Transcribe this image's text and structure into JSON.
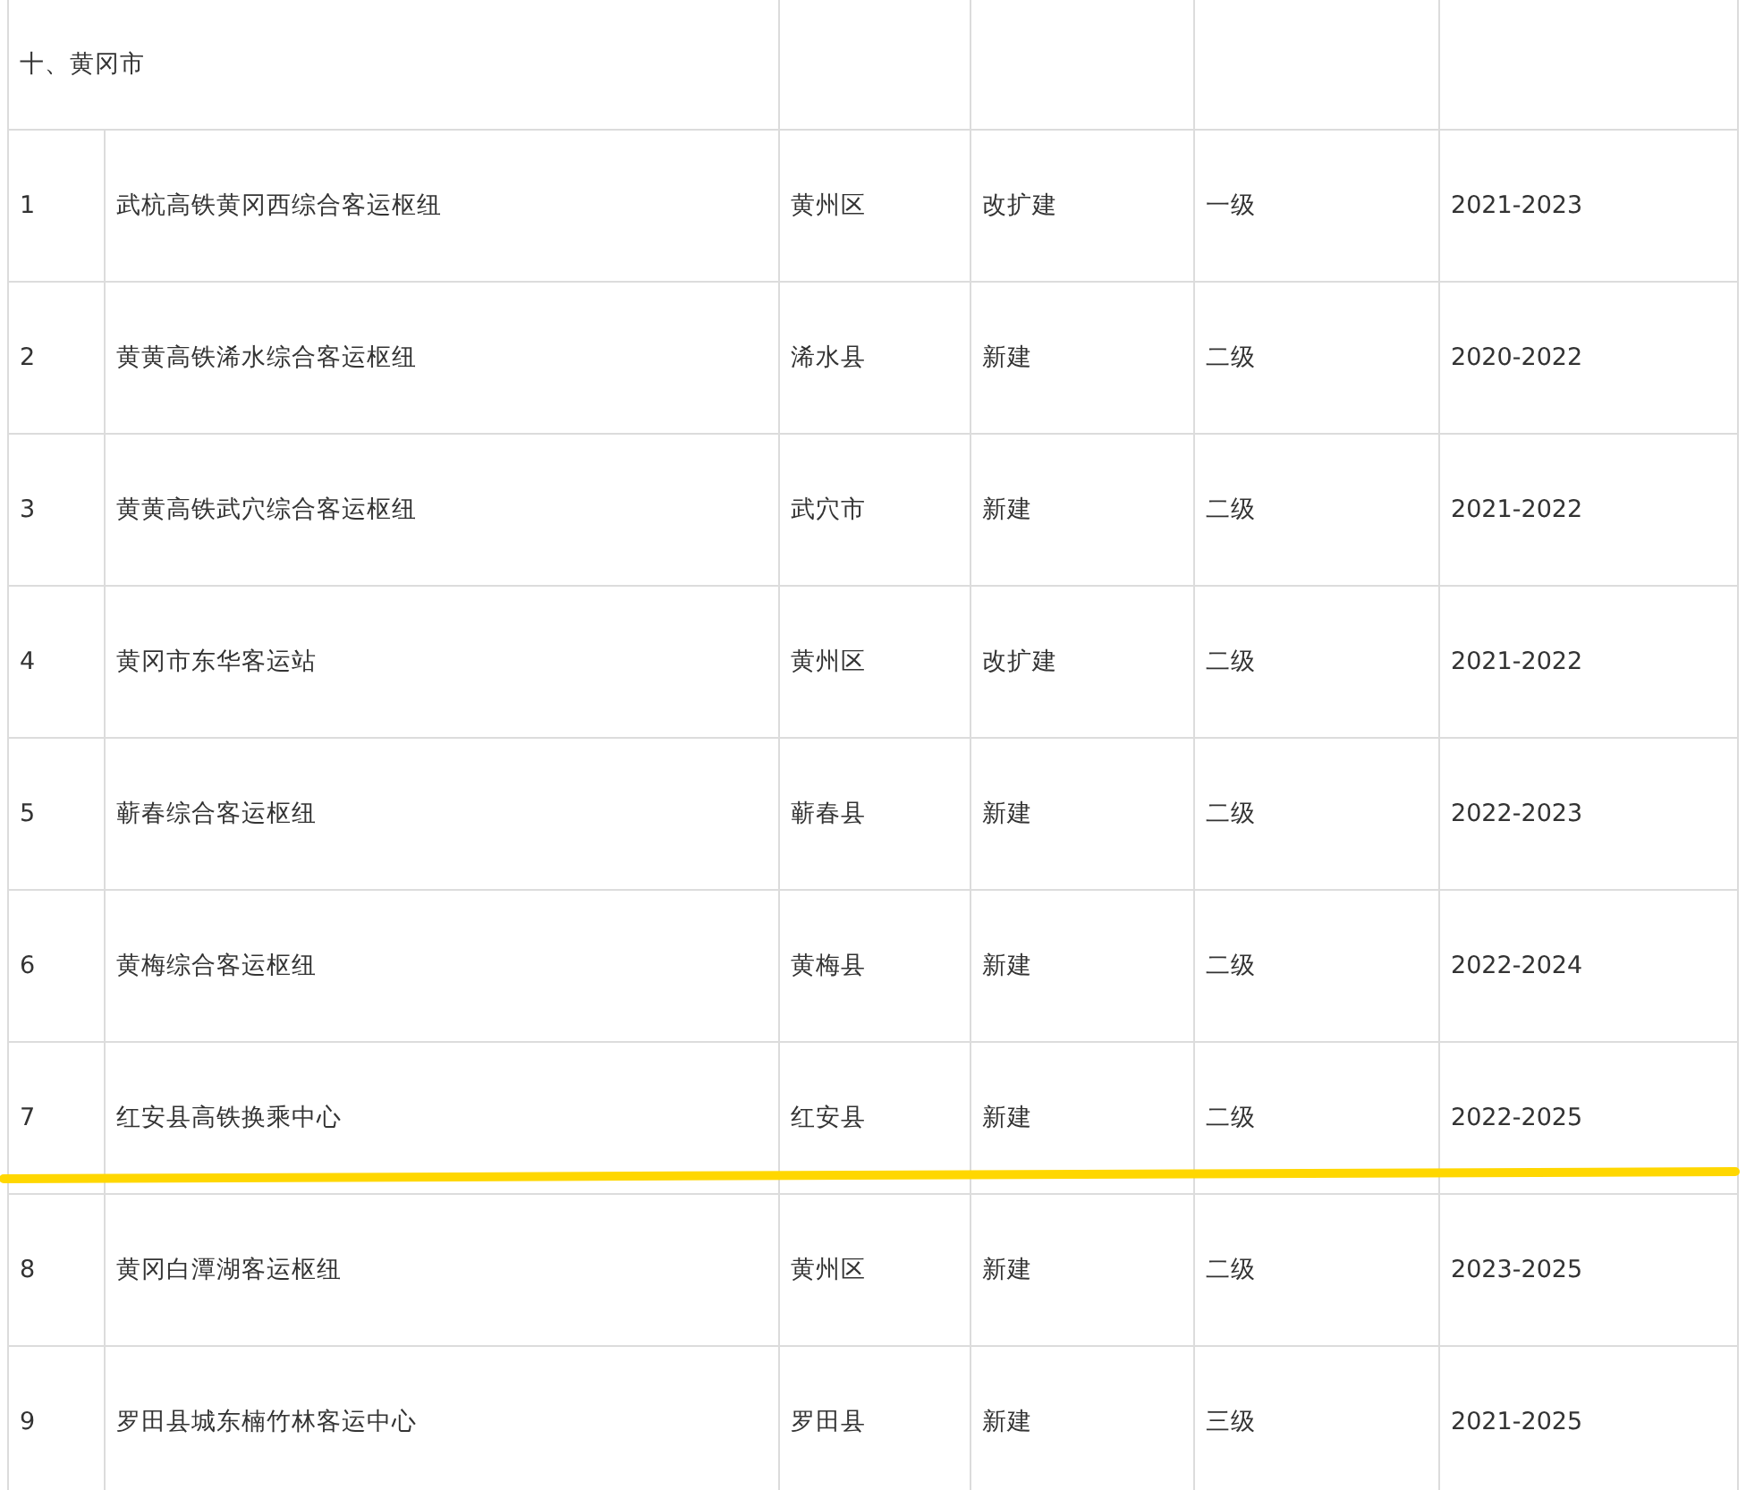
{
  "table": {
    "section_title": "十、黄冈市",
    "rows": [
      {
        "cells": [
          "1",
          "武杭高铁黄冈西综合客运枢纽",
          "黄州区",
          "改扩建",
          "一级",
          "2021-2023"
        ]
      },
      {
        "cells": [
          "2",
          "黄黄高铁浠水综合客运枢纽",
          "浠水县",
          "新建",
          "二级",
          "2020-2022"
        ]
      },
      {
        "cells": [
          "3",
          "黄黄高铁武穴综合客运枢纽",
          "武穴市",
          "新建",
          "二级",
          "2021-2022"
        ]
      },
      {
        "cells": [
          "4",
          "黄冈市东华客运站",
          "黄州区",
          "改扩建",
          "二级",
          "2021-2022"
        ]
      },
      {
        "cells": [
          "5",
          "蕲春综合客运枢纽",
          "蕲春县",
          "新建",
          "二级",
          "2022-2023"
        ]
      },
      {
        "cells": [
          "6",
          "黄梅综合客运枢纽",
          "黄梅县",
          "新建",
          "二级",
          "2022-2024"
        ]
      },
      {
        "cells": [
          "7",
          "红安县高铁换乘中心",
          "红安县",
          "新建",
          "二级",
          "2022-2025"
        ]
      },
      {
        "cells": [
          "8",
          "黄冈白潭湖客运枢纽",
          "黄州区",
          "新建",
          "二级",
          "2023-2025"
        ]
      },
      {
        "cells": [
          "9",
          "罗田县城东楠竹林客运中心",
          "罗田县",
          "新建",
          "三级",
          "2021-2025"
        ]
      }
    ]
  }
}
